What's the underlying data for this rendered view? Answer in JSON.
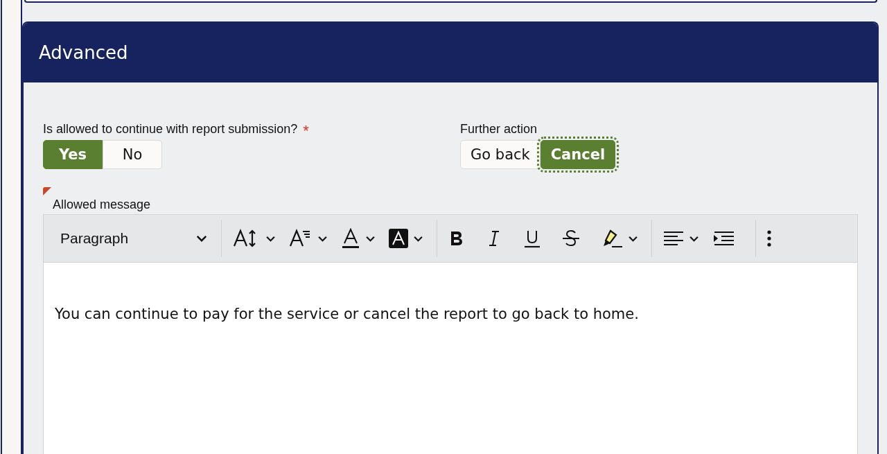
{
  "panel": {
    "title": "Advanced"
  },
  "allowed_question": {
    "label": "Is allowed to continue with report submission?",
    "required_mark": "*",
    "options": [
      {
        "label": "Yes",
        "selected": true,
        "focused": false
      },
      {
        "label": "No",
        "selected": false,
        "focused": false
      }
    ]
  },
  "further_action": {
    "label": "Further action",
    "options": [
      {
        "label": "Go back",
        "selected": false,
        "focused": false
      },
      {
        "label": "Cancel",
        "selected": true,
        "focused": true
      }
    ]
  },
  "message_field": {
    "label": "Allowed message",
    "flagged": true,
    "block_format": "Paragraph",
    "value": "You can continue to pay for the service or cancel the report to go back to home."
  }
}
